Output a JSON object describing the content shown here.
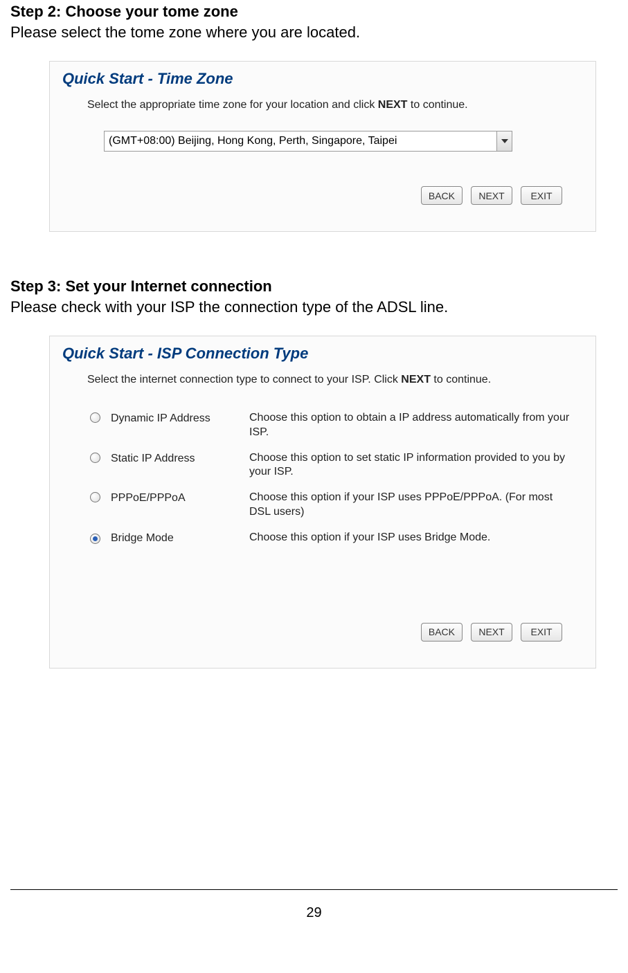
{
  "step2": {
    "heading": "Step 2: Choose your tome zone",
    "desc": "Please select the tome zone where you are located.",
    "panel_title": "Quick Start - Time Zone",
    "instruction_pre": "Select the appropriate time zone for your location and click ",
    "instruction_bold": "NEXT",
    "instruction_post": " to continue.",
    "tz_value": "(GMT+08:00) Beijing, Hong Kong, Perth, Singapore, Taipei",
    "btn_back": "BACK",
    "btn_next": "NEXT",
    "btn_exit": "EXIT"
  },
  "step3": {
    "heading": "Step 3: Set your Internet connection",
    "desc": "Please check with your ISP the connection type of the ADSL line.",
    "panel_title": "Quick Start - ISP Connection Type",
    "instruction_pre": "Select the internet connection type to connect to your ISP. Click ",
    "instruction_bold": "NEXT",
    "instruction_post": " to continue.",
    "options": [
      {
        "label": "Dynamic IP Address",
        "desc": "Choose this option to obtain a IP address automatically from your ISP.",
        "checked": false
      },
      {
        "label": "Static IP Address",
        "desc": "Choose this option to set static IP information provided to you by your ISP.",
        "checked": false
      },
      {
        "label": "PPPoE/PPPoA",
        "desc": "Choose this option if your ISP uses PPPoE/PPPoA. (For most DSL users)",
        "checked": false
      },
      {
        "label": "Bridge Mode",
        "desc": "Choose this option if your ISP uses Bridge Mode.",
        "checked": true
      }
    ],
    "btn_back": "BACK",
    "btn_next": "NEXT",
    "btn_exit": "EXIT"
  },
  "page_number": "29"
}
